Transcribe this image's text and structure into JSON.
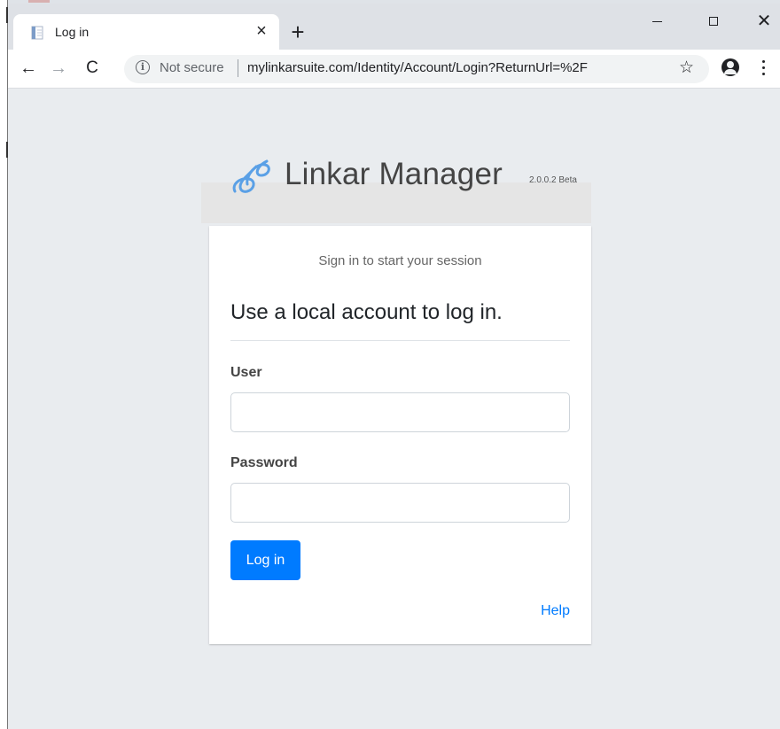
{
  "browser": {
    "tab_title": "Log in",
    "tab_close": "×",
    "new_tab": "+",
    "window_close": "✕",
    "nav": {
      "back": "←",
      "forward": "→",
      "reload": "C"
    },
    "omnibox": {
      "info_glyph": "i",
      "security_text": "Not secure",
      "url": "mylinkarsuite.com/Identity/Account/Login?ReturnUrl=%2F",
      "bookmark_glyph": "☆"
    }
  },
  "brand": {
    "name": "Linkar Manager",
    "version": "2.0.0.2 Beta",
    "logo_color": "#5aa0e6"
  },
  "login": {
    "subtitle": "Sign in to start your session",
    "heading": "Use a local account to log in.",
    "user_label": "User",
    "user_value": "",
    "password_label": "Password",
    "password_value": "",
    "submit_label": "Log in",
    "help_label": "Help"
  },
  "colors": {
    "primary": "#007bff",
    "page_background": "#e9ecef",
    "chrome_background": "#dee1e6"
  }
}
